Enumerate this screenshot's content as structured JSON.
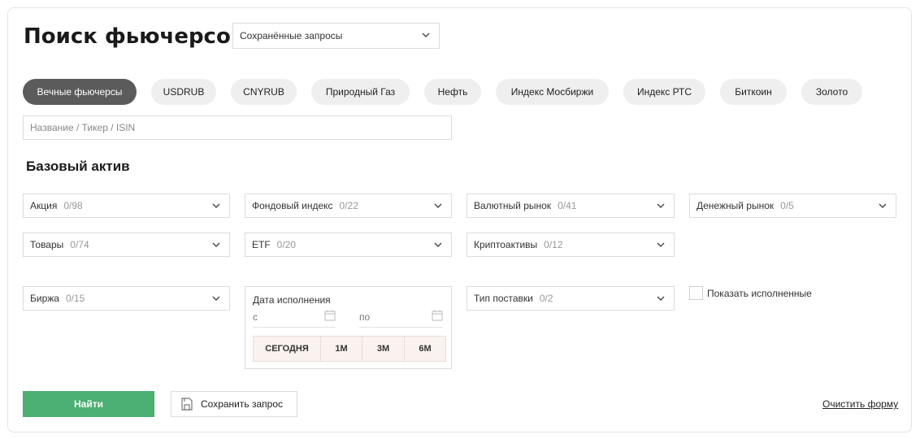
{
  "page": {
    "title": "Поиск фьючерсов",
    "saved_queries": {
      "label": "Сохранённые запросы"
    }
  },
  "chips": [
    {
      "label": "Вечные фьючерсы",
      "active": true
    },
    {
      "label": "USDRUB",
      "active": false
    },
    {
      "label": "CNYRUB",
      "active": false
    },
    {
      "label": "Природный Газ",
      "active": false
    },
    {
      "label": "Нефть",
      "active": false
    },
    {
      "label": "Индекс Мосбиржи",
      "active": false
    },
    {
      "label": "Индекс РТС",
      "active": false
    },
    {
      "label": "Биткоин",
      "active": false
    },
    {
      "label": "Золото",
      "active": false
    }
  ],
  "search": {
    "placeholder": "Название / Тикер / ISIN",
    "value": ""
  },
  "base_asset": {
    "title": "Базовый актив",
    "filters": [
      {
        "label": "Акция",
        "count": "0/98"
      },
      {
        "label": "Фондовый индекс",
        "count": "0/22"
      },
      {
        "label": "Валютный рынок",
        "count": "0/41"
      },
      {
        "label": "Денежный рынок",
        "count": "0/5"
      },
      {
        "label": "Товары",
        "count": "0/74"
      },
      {
        "label": "ETF",
        "count": "0/20"
      },
      {
        "label": "Криптоактивы",
        "count": "0/12"
      }
    ]
  },
  "exchange": {
    "label": "Биржа",
    "count": "0/15"
  },
  "expiry": {
    "label": "Дата исполнения",
    "from_label": "с",
    "to_label": "по",
    "periods": [
      "СЕГОДНЯ",
      "1М",
      "3М",
      "6М"
    ]
  },
  "delivery": {
    "label": "Тип поставки",
    "count": "0/2"
  },
  "show_executed": {
    "label": "Показать исполненные",
    "checked": false
  },
  "actions": {
    "find": "Найти",
    "save": "Сохранить запрос",
    "clear": "Очистить форму"
  },
  "colors": {
    "primary": "#4caf74",
    "chip_active": "#5b5b5b",
    "chip_bg": "#efefef"
  }
}
